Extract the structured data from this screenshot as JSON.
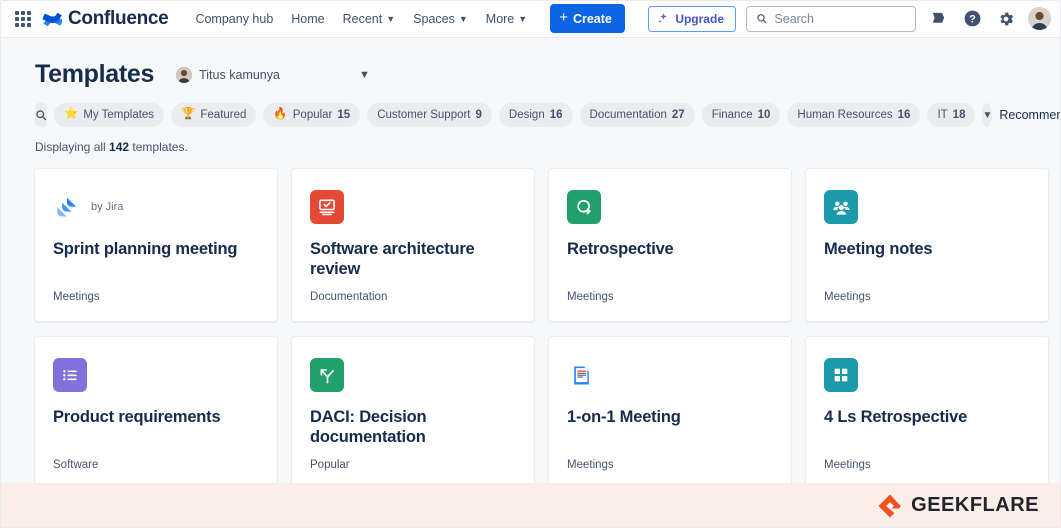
{
  "topnav": {
    "app_switcher": "app-switcher",
    "brand": "Confluence",
    "links": [
      {
        "label": "Company hub",
        "has_caret": false
      },
      {
        "label": "Home",
        "has_caret": false
      },
      {
        "label": "Recent",
        "has_caret": true
      },
      {
        "label": "Spaces",
        "has_caret": true
      },
      {
        "label": "More",
        "has_caret": true
      }
    ],
    "create_label": "Create",
    "upgrade_label": "Upgrade",
    "search_placeholder": "Search",
    "icons": [
      "notifications-icon",
      "help-icon",
      "settings-icon",
      "profile-avatar"
    ]
  },
  "page": {
    "title": "Templates",
    "owner": "Titus kamunya",
    "displaying_prefix": "Displaying all",
    "displaying_count": "142",
    "displaying_suffix": "templates.",
    "sort_label": "Recommended"
  },
  "filters": [
    {
      "label": "My Templates",
      "emoji": "⭐",
      "count": ""
    },
    {
      "label": "Featured",
      "emoji": "🏆",
      "count": ""
    },
    {
      "label": "Popular",
      "emoji": "🔥",
      "count": "15"
    },
    {
      "label": "Customer Support",
      "emoji": "",
      "count": "9"
    },
    {
      "label": "Design",
      "emoji": "",
      "count": "16"
    },
    {
      "label": "Documentation",
      "emoji": "",
      "count": "27"
    },
    {
      "label": "Finance",
      "emoji": "",
      "count": "10"
    },
    {
      "label": "Human Resources",
      "emoji": "",
      "count": "16"
    },
    {
      "label": "IT",
      "emoji": "",
      "count": "18"
    }
  ],
  "templates": [
    {
      "title": "Sprint planning meeting",
      "category": "Meetings",
      "byline": "by Jira",
      "icon": "jira-icon",
      "tile_color": "#ffffff"
    },
    {
      "title": "Software architecture review",
      "category": "Documentation",
      "byline": "",
      "icon": "monitor-check-icon",
      "tile_color": "#e34935"
    },
    {
      "title": "Retrospective",
      "category": "Meetings",
      "byline": "",
      "icon": "retro-loop-icon",
      "tile_color": "#22a06b"
    },
    {
      "title": "Meeting notes",
      "category": "Meetings",
      "byline": "",
      "icon": "people-group-icon",
      "tile_color": "#1d9aaa"
    },
    {
      "title": "Product requirements",
      "category": "Software",
      "byline": "",
      "icon": "list-bullets-icon",
      "tile_color": "#8270db"
    },
    {
      "title": "DACI: Decision documentation",
      "category": "Popular",
      "byline": "",
      "icon": "fork-arrow-icon",
      "tile_color": "#22a06b"
    },
    {
      "title": "1-on-1 Meeting",
      "category": "Meetings",
      "byline": "",
      "icon": "document-page-icon",
      "tile_color": "#ffffff"
    },
    {
      "title": "4 Ls Retrospective",
      "category": "Meetings",
      "byline": "",
      "icon": "grid-four-icon",
      "tile_color": "#1d9aaa"
    }
  ],
  "watermark": {
    "text": "GEEKFLARE",
    "accent": "#f05323",
    "bar_color": "#fbeee9"
  },
  "colors": {
    "primary_blue": "#0c66e4",
    "text_dark": "#172b4d",
    "text_muted": "#44546f",
    "page_bg": "#f7f8f9"
  }
}
